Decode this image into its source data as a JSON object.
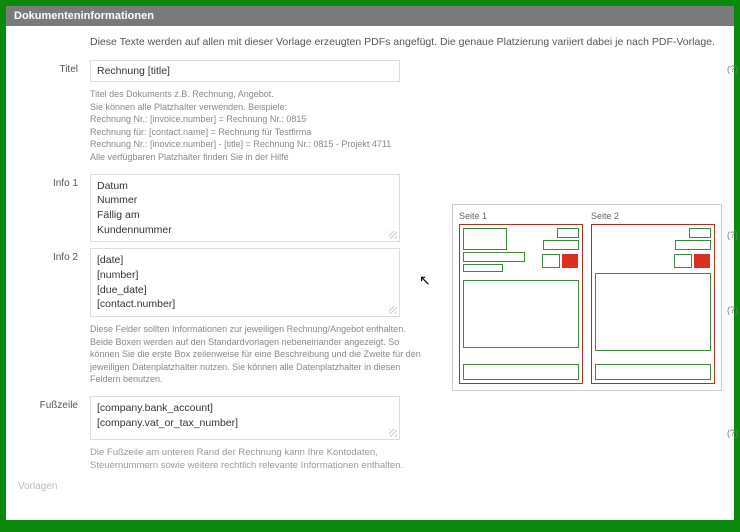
{
  "header": {
    "title": "Dokumenteninformationen"
  },
  "intro": "Diese Texte werden auf allen mit dieser Vorlage erzeugten PDFs angefügt. Die genaue Platzierung variiert dabei je nach PDF-Vorlage.",
  "titel": {
    "label": "Titel",
    "value": "Rechnung [title]",
    "q": "(?)",
    "help": "Titel des Dokuments z.B. Rechnung, Angebot.\nSie können alle Platzhalter verwenden. Beispiele:\nRechnung Nr.: [invoice.number] = Rechnung Nr.: 0815\nRechnung für: [contact.name] = Rechnung für Testfirma\nRechnung Nr.: [inovice.number] - [title] = Rechnung Nr.: 0815 - Projekt 4711\nAlle verfügbaren Platzhalter finden Sie in der Hilfe"
  },
  "info1": {
    "label": "Info 1",
    "value": "Datum\nNummer\nFällig am\nKundennummer",
    "q": "(?)"
  },
  "info2": {
    "label": "Info 2",
    "value": "[date]\n[number]\n[due_date]\n[contact.number]",
    "q": "(?)",
    "help": "Diese Felder sollten Informationen zur jeweiligen Rechnung/Angebot enthalten. Beide Boxen werden auf den Standardvorlagen nebeneinander angezeigt. So können Sie die erste Box zeilenweise für eine Beschreibung und die Zweite für den jeweiligen Datenplatzhalter nutzen. Sie können alle Datenplatzhalter in diesen Feldern benutzen."
  },
  "fusszeile": {
    "label": "Fußzeile",
    "value": "[company.bank_account]\n[company.vat_or_tax_number]",
    "q": "(?)",
    "help": "Die Fußzeile am unteren Rand der Rechnung kann Ihre Kontodaten, Steuernummern sowie weitere rechtlich relevante Informationen enthalten."
  },
  "preview": {
    "page1": "Seite 1",
    "page2": "Seite 2"
  },
  "footer_tab": "Vorlagen"
}
